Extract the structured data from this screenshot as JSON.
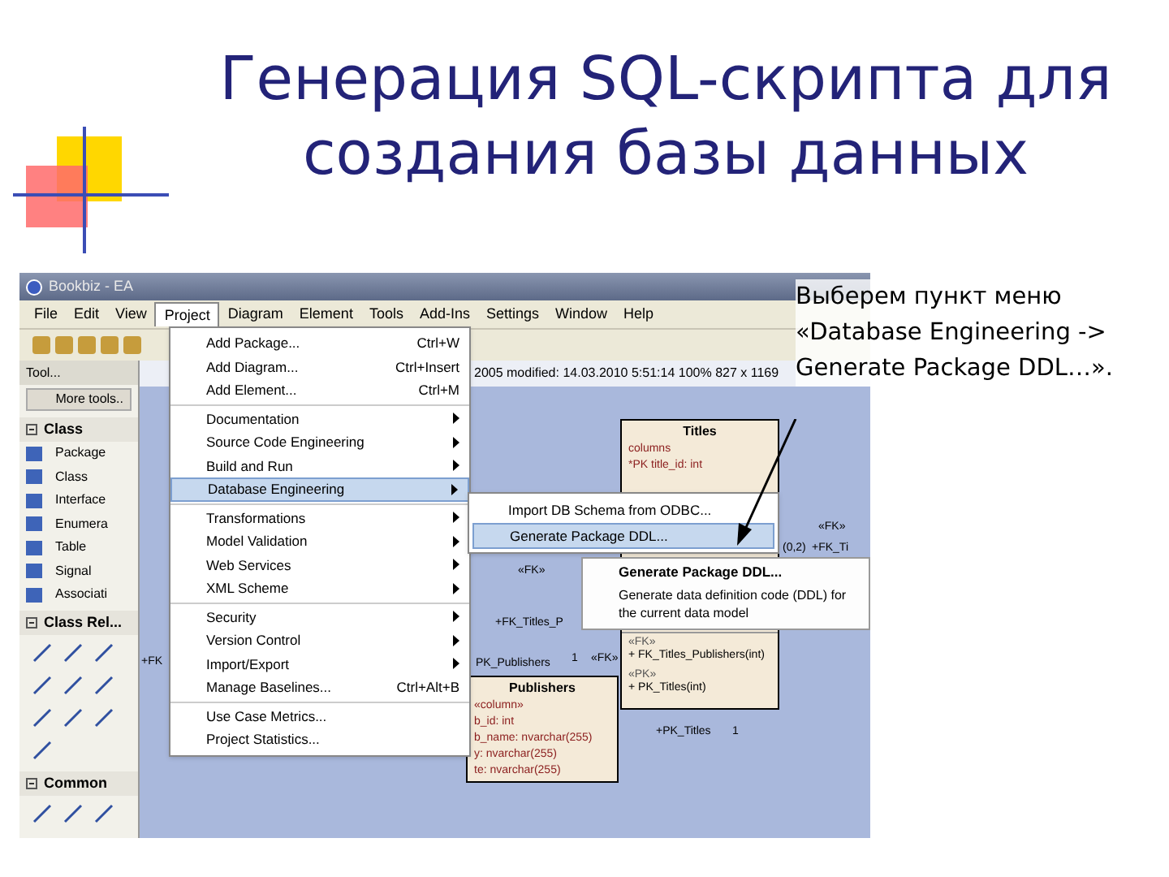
{
  "slide": {
    "title_lines": [
      "Генерация SQL-скрипта для",
      "создания базы данных"
    ],
    "callout_lines": [
      "Выберем пункт меню",
      "«Database Engineering ->",
      "Generate Package DDL…»."
    ]
  },
  "app": {
    "window_title": "Bookbiz - EA",
    "menubar": [
      {
        "label": "File",
        "selected": false
      },
      {
        "label": "Edit",
        "selected": false
      },
      {
        "label": "View",
        "selected": false
      },
      {
        "label": "Project",
        "selected": true
      },
      {
        "label": "Diagram",
        "selected": false
      },
      {
        "label": "Element",
        "selected": false
      },
      {
        "label": "Tools",
        "selected": false
      },
      {
        "label": "Add-Ins",
        "selected": false
      },
      {
        "label": "Settings",
        "selected": false
      },
      {
        "label": "Window",
        "selected": false
      },
      {
        "label": "Help",
        "selected": false
      }
    ],
    "toolbox": {
      "title": "Tool...",
      "more_tools": "More tools..",
      "sections": [
        {
          "title": "Class",
          "kind": "list",
          "items": [
            "Package",
            "Class",
            "Interface",
            "Enumera",
            "Table",
            "Signal",
            "Associati"
          ]
        },
        {
          "title": "Class Rel...",
          "kind": "icons"
        },
        {
          "title": "Common",
          "kind": "icons"
        }
      ]
    },
    "diagram_info": "2005 modified: 14.03.2010  5:51:14   100%   827 x 1169",
    "project_menu": [
      [
        {
          "label": "Add Package...",
          "shortcut": "Ctrl+W",
          "submenu": false,
          "selected": false
        },
        {
          "label": "Add Diagram...",
          "shortcut": "Ctrl+Insert",
          "submenu": false,
          "selected": false
        },
        {
          "label": "Add Element...",
          "shortcut": "Ctrl+M",
          "submenu": false,
          "selected": false
        }
      ],
      [
        {
          "label": "Documentation",
          "submenu": true,
          "selected": false
        },
        {
          "label": "Source Code Engineering",
          "submenu": true,
          "selected": false
        },
        {
          "label": "Build and Run",
          "submenu": true,
          "selected": false
        },
        {
          "label": "Database Engineering",
          "submenu": true,
          "selected": true
        }
      ],
      [
        {
          "label": "Transformations",
          "submenu": true,
          "selected": false
        },
        {
          "label": "Model Validation",
          "submenu": true,
          "selected": false
        },
        {
          "label": "Web Services",
          "submenu": true,
          "selected": false
        },
        {
          "label": "XML Scheme",
          "submenu": true,
          "selected": false
        }
      ],
      [
        {
          "label": "Security",
          "submenu": true,
          "selected": false
        },
        {
          "label": "Version Control",
          "submenu": true,
          "selected": false
        },
        {
          "label": "Import/Export",
          "submenu": true,
          "selected": false
        },
        {
          "label": "Manage Baselines...",
          "shortcut": "Ctrl+Alt+B",
          "submenu": false,
          "selected": false
        }
      ],
      [
        {
          "label": "Use Case Metrics...",
          "submenu": false,
          "selected": false
        },
        {
          "label": "Project Statistics...",
          "submenu": false,
          "selected": false
        }
      ]
    ],
    "submenu": [
      {
        "label": "Import DB Schema from ODBC...",
        "selected": false
      },
      {
        "label": "Generate Package DDL...",
        "selected": true
      }
    ],
    "tooltip": {
      "title": "Generate Package DDL...",
      "text": "Generate data definition code (DDL) for the current data model"
    },
    "tables": [
      {
        "name": "Titles",
        "top_lines": [
          "columns",
          "*PK title_id: int"
        ],
        "fk_label": "«FK»",
        "fk": "+ FK_Titles_Publishers(int)",
        "pk_label": "«PK»",
        "pk": "+ PK_Titles(int)"
      },
      {
        "name": "Publishers",
        "top_lines": [
          "«column»",
          "b_id: int",
          "b_name: nvarchar(255)",
          "y: nvarchar(255)",
          "te: nvarchar(255)"
        ]
      }
    ],
    "labels": [
      "+FK",
      "«FK»",
      "+FK_Titles_P",
      "«FK»",
      "PK_Publishers",
      "1",
      "+PK_Titles",
      "1",
      "(0,2)",
      "+FK_Ti",
      "«FK»"
    ]
  }
}
